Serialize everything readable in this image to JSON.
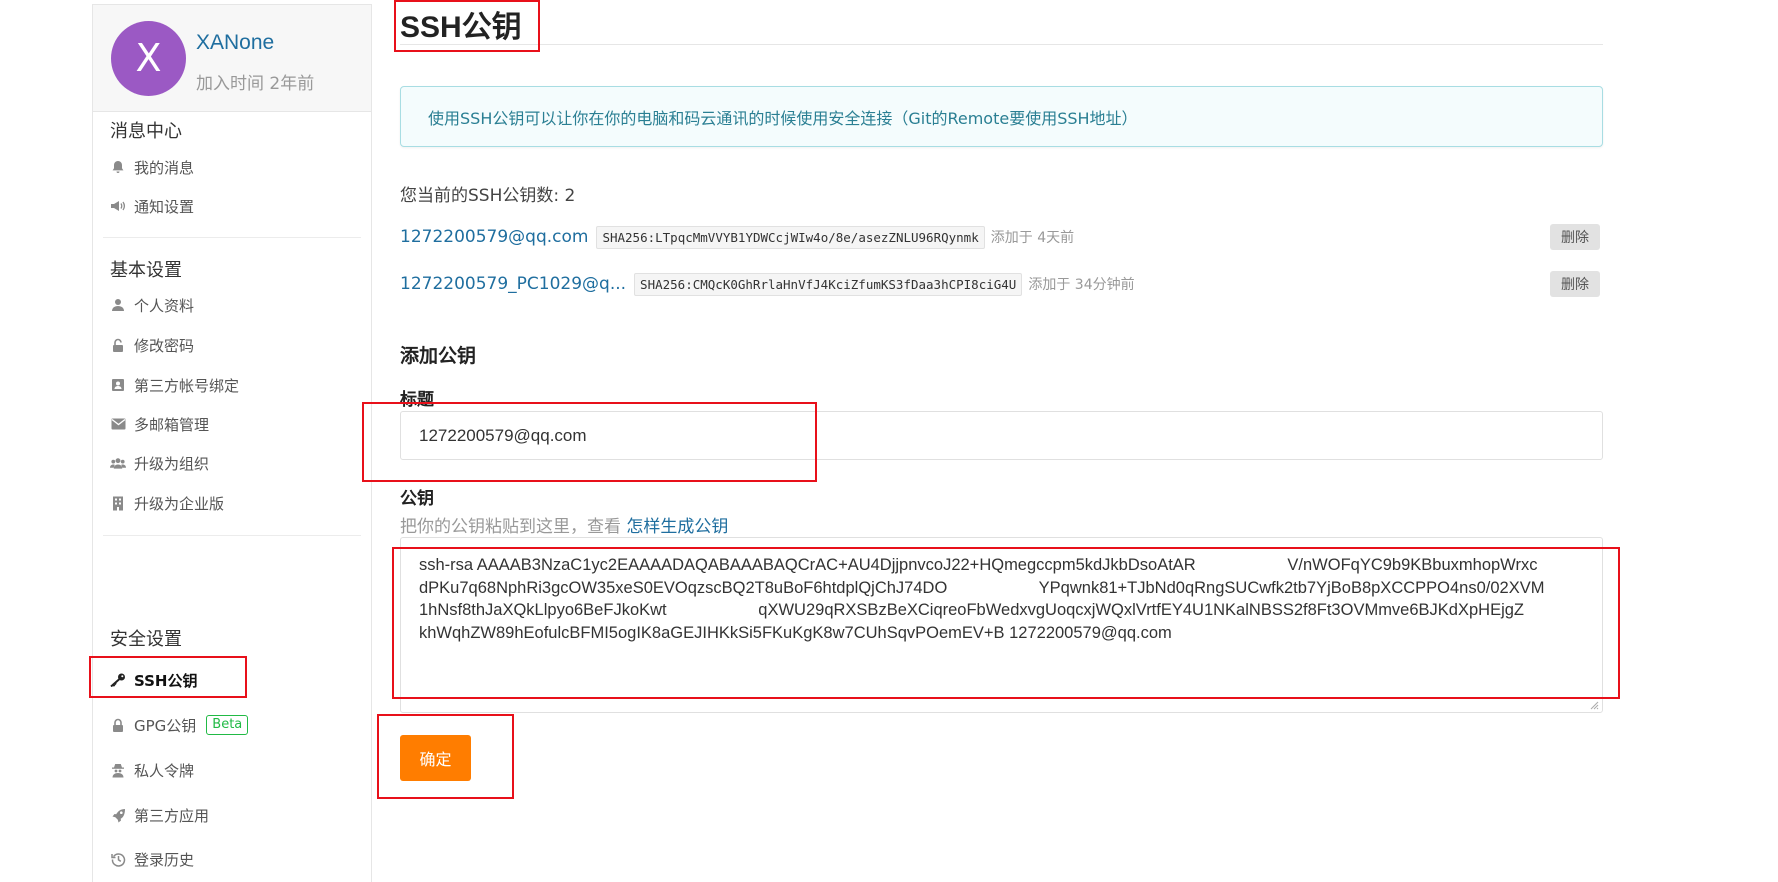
{
  "user": {
    "avatar_letter": "X",
    "avatar_color": "#9b59c4",
    "name": "XANone",
    "joined": "加入时间 2年前"
  },
  "sidebar": {
    "groups": [
      {
        "title": "消息中心",
        "items": [
          {
            "label": "我的消息",
            "icon": "bell-icon"
          },
          {
            "label": "通知设置",
            "icon": "megaphone-icon"
          }
        ]
      },
      {
        "title": "基本设置",
        "items": [
          {
            "label": "个人资料",
            "icon": "user-icon"
          },
          {
            "label": "修改密码",
            "icon": "unlock-icon"
          },
          {
            "label": "第三方帐号绑定",
            "icon": "contact-card-icon"
          },
          {
            "label": "多邮箱管理",
            "icon": "envelope-icon"
          },
          {
            "label": "升级为组织",
            "icon": "users-icon"
          },
          {
            "label": "升级为企业版",
            "icon": "building-icon"
          }
        ]
      },
      {
        "title": "安全设置",
        "items": [
          {
            "label": "SSH公钥",
            "icon": "key-icon",
            "active": true
          },
          {
            "label": "GPG公钥",
            "icon": "lock-icon",
            "badge": "Beta"
          },
          {
            "label": "私人令牌",
            "icon": "user-secret-icon"
          },
          {
            "label": "第三方应用",
            "icon": "rocket-icon"
          },
          {
            "label": "登录历史",
            "icon": "history-icon"
          }
        ]
      }
    ]
  },
  "main": {
    "title": "SSH公钥",
    "info": "使用SSH公钥可以让你在你的电脑和码云通讯的时候使用安全连接（Git的Remote要使用SSH地址）",
    "key_count": "您当前的SSH公钥数: 2",
    "keys": [
      {
        "name": "1272200579@qq.com",
        "fingerprint": "SHA256:LTpqcMmVVYB1YDWCcjWIw4o/8e/asezZNLU96RQynmk",
        "added": "添加于 4天前",
        "delete_label": "删除"
      },
      {
        "name": "1272200579_PC1029@q...",
        "fingerprint": "SHA256:CMQcK0GhRrlaHnVfJ4KciZfumKS3fDaa3hCPI8ciG4U",
        "added": "添加于 34分钟前",
        "delete_label": "删除"
      }
    ],
    "add_section": "添加公钥",
    "title_label": "标题",
    "title_value": "1272200579@qq.com",
    "key_label": "公钥",
    "hint_text": "把你的公钥粘贴到这里，查看 ",
    "hint_link": "怎样生成公钥",
    "key_value": "ssh-rsa AAAAB3NzaC1yc2EAAAADAQABAAABAQCrAC+AU4DjjpnvcoJ22+HQmegccpm5kdJkbDsoAtAR                    V/nWOFqYC9b9KBbuxmhopWrxc\ndPKu7q68NphRi3gcOW35xeS0EVOqzscBQ2T8uBoF6htdplQjChJ74DO                    YPqwnk81+TJbNd0qRngSUCwfk2tb7YjBoB8pXCCPPO4ns0/02XVM\n1hNsf8thJaXQkLlpyo6BeFJkoKwt                    qXWU29qRXSBzBeXCiqreoFbWedxvgUoqcxjWQxlVrtfEY4U1NKalNBSS2f8Ft3OVMmve6BJKdXpHEjgZ\nkhWqhZW89hEofulcBFMI5ogIK8aGEJIHKkSi5FKuKgK8w7CUhSqvPOemEV+B 1272200579@qq.com",
    "submit_label": "确定"
  },
  "colors": {
    "link": "#1f6e9f",
    "submit": "#ff7d00",
    "info_bg": "#f4fcfd",
    "info_text": "#2a7f93",
    "annotation": "#e8101a",
    "beta": "#21ba45"
  }
}
